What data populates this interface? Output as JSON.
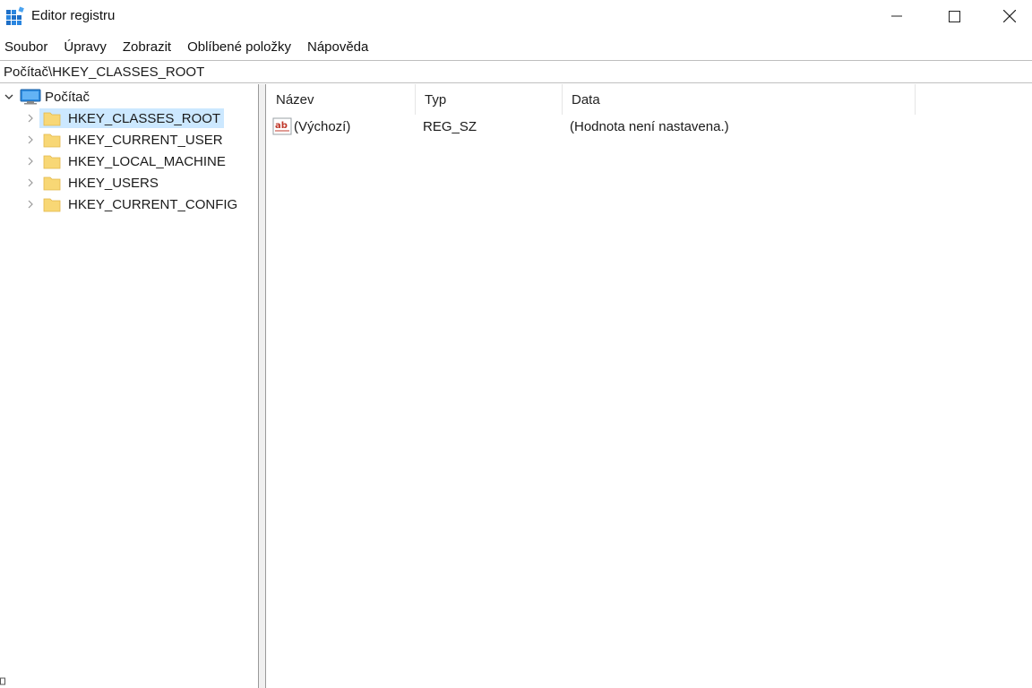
{
  "window": {
    "title": "Editor registru",
    "app_icon": "registry-editor-icon",
    "controls": [
      "minimize-icon",
      "maximize-icon",
      "close-icon"
    ]
  },
  "menu": {
    "items": [
      "Soubor",
      "Úpravy",
      "Zobrazit",
      "Oblíbené položky",
      "Nápověda"
    ]
  },
  "address": {
    "path": "Počítač\\HKEY_CLASSES_ROOT"
  },
  "tree": {
    "root": {
      "label": "Počítač",
      "icon": "computer-icon",
      "expanded": true
    },
    "children": [
      {
        "label": "HKEY_CLASSES_ROOT",
        "icon": "folder-icon",
        "selected": true
      },
      {
        "label": "HKEY_CURRENT_USER",
        "icon": "folder-icon",
        "selected": false
      },
      {
        "label": "HKEY_LOCAL_MACHINE",
        "icon": "folder-icon",
        "selected": false
      },
      {
        "label": "HKEY_USERS",
        "icon": "folder-icon",
        "selected": false
      },
      {
        "label": "HKEY_CURRENT_CONFIG",
        "icon": "folder-icon",
        "selected": false
      }
    ]
  },
  "list": {
    "columns": [
      "Název",
      "Typ",
      "Data"
    ],
    "rows": [
      {
        "name": "(Výchozí)",
        "type": "REG_SZ",
        "data": "(Hodnota není nastavena.)",
        "icon": "string-value-icon"
      }
    ]
  },
  "colors": {
    "selection": "#cce8ff",
    "folder": "#f8d775",
    "accent": "#0078d7"
  }
}
